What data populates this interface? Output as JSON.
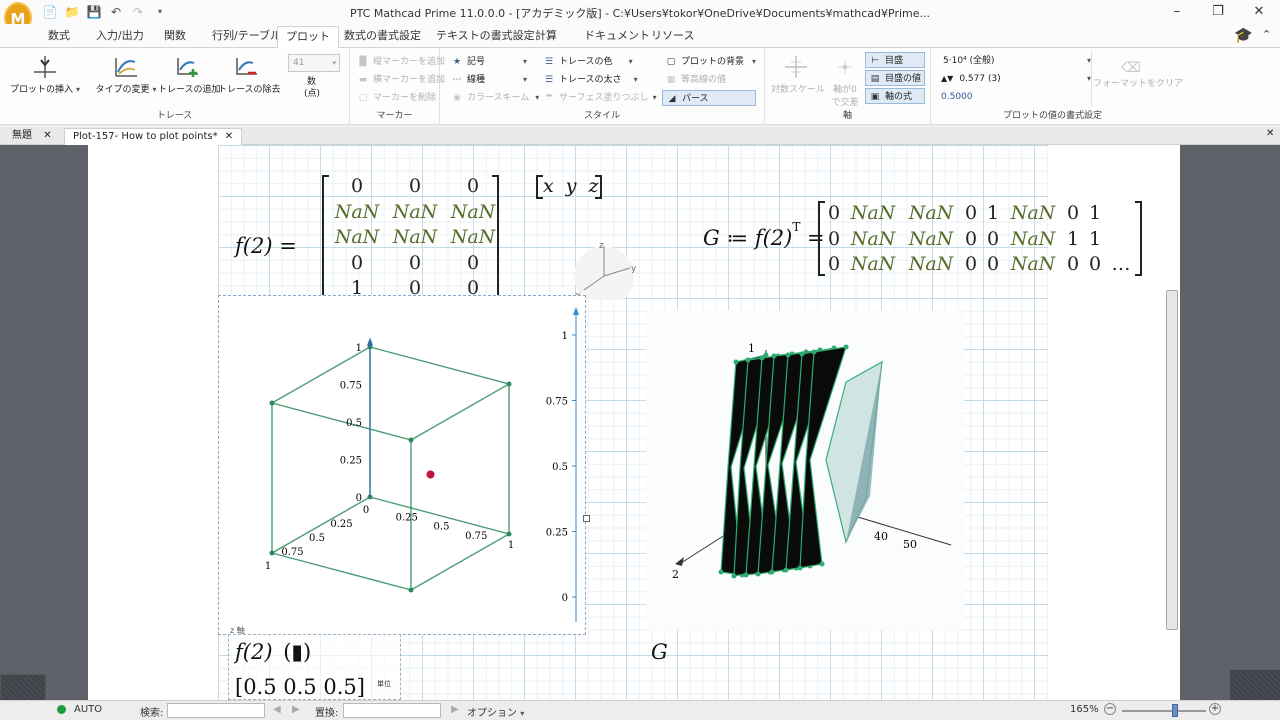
{
  "app": {
    "title": "PTC Mathcad Prime 11.0.0.0 - [アカデミック版] - C:¥Users¥tokor¥OneDrive¥Documents¥mathcad¥Prime...",
    "logo": "M"
  },
  "ribbon_tabs": [
    "数式",
    "入力/出力",
    "関数",
    "行列/テーブル",
    "プロット",
    "数式の書式設定",
    "テキストの書式設定",
    "計算",
    "ドキュメント",
    "リソース"
  ],
  "ribbon": {
    "trace": {
      "label": "トレース",
      "insert_plot": "プロットの挿入",
      "change_type": "タイプの変更",
      "add_trace": "トレースの追加",
      "remove_trace": "トレースの除去",
      "count_value": "41",
      "count_label_1": "数",
      "count_label_2": "(点)"
    },
    "marker": {
      "label": "マーカー",
      "add_vertical": "縦マーカーを追加",
      "add_horizontal": "横マーカーを追加",
      "delete": "マーカーを削除"
    },
    "style": {
      "label": "スタイル",
      "symbol": "記号",
      "line_style": "線種",
      "color_scheme": "カラースキーム",
      "trace_color": "トレースの色",
      "trace_weight": "トレースの太さ",
      "surface_fill": "サーフェス塗りつぶし",
      "plot_background": "プロットの背景",
      "contour_values": "等高線の値",
      "perspective": "パース"
    },
    "axes": {
      "label": "軸",
      "log_scale": "対数スケール",
      "axes_cross_1": "軸が0",
      "axes_cross_2": "で交差",
      "ticks": "目盛",
      "tick_values": "目盛の値",
      "axis_expression": "軸の式"
    },
    "format": {
      "label": "プロットの値の書式設定",
      "format_1": "5·10⁴ (全般)",
      "format_2": "0.577 (3)",
      "format_3": "0.5000",
      "clear": "フォーマットをクリア"
    }
  },
  "doc_tabs": [
    {
      "label": "無題",
      "active": false
    },
    {
      "label": "Plot-157- How to plot points*",
      "active": true
    }
  ],
  "worksheet": {
    "f2_label": "f(2) =",
    "f2_matrix": [
      [
        "0",
        "0",
        "0"
      ],
      [
        "NaN",
        "NaN",
        "NaN"
      ],
      [
        "NaN",
        "NaN",
        "NaN"
      ],
      [
        "0",
        "0",
        "0"
      ],
      [
        "1",
        "0",
        "0"
      ]
    ],
    "xyz": [
      "x",
      "y",
      "z"
    ],
    "g_def": "G ≔ f(2)",
    "g_sup": "T",
    "g_equals": "=",
    "g_matrix": [
      [
        "0",
        "NaN",
        "NaN",
        "0",
        "1",
        "NaN",
        "0",
        "1",
        ""
      ],
      [
        "0",
        "NaN",
        "NaN",
        "0",
        "0",
        "NaN",
        "1",
        "1",
        ""
      ],
      [
        "0",
        "NaN",
        "NaN",
        "0",
        "0",
        "NaN",
        "0",
        "0",
        "…"
      ]
    ],
    "plot1_trace_label": "z 軸",
    "plot1_expr": "f(2)",
    "plot1_expr_paren": "(▮)",
    "plot1_vector": "[0.5  0.5  0.5]",
    "plot1_unit": "単位",
    "g_label": "G",
    "orient": {
      "x": "x",
      "y": "y",
      "z": "z"
    }
  },
  "chart_data": [
    {
      "type": "scatter",
      "three_d": true,
      "points": [
        {
          "x": 0.5,
          "y": 0.5,
          "z": 0.5
        }
      ],
      "axis_ticks": {
        "x": [
          "1",
          "0.75",
          "0.5",
          "0.25",
          "0"
        ],
        "y": [
          "0.25",
          "0.5",
          "0.75",
          "1"
        ],
        "z": [
          "0",
          "0.25",
          "0.5",
          "0.75",
          "1"
        ]
      },
      "zlim": [
        0,
        1
      ],
      "point_color": "#c0143c",
      "box_color": "#2e8b5e"
    },
    {
      "type": "line",
      "scale_ticks": [
        "0",
        "0.25",
        "0.5",
        "0.75",
        "1"
      ],
      "ylim": [
        0,
        1
      ]
    },
    {
      "type": "surface",
      "three_d": true,
      "axis_ticks": {
        "x": [
          "40",
          "50"
        ],
        "y": [
          "2"
        ],
        "z": [
          "1"
        ]
      },
      "fill_color": "#0a0a0a",
      "edge_color": "#2eaa6e"
    }
  ],
  "tools": [
    "rotate-icon",
    "pan-icon",
    "zoom-icon",
    "reset-icon"
  ],
  "status": {
    "mode": "AUTO",
    "search_label": "検索:",
    "replace_label": "置換:",
    "options_label": "オプション",
    "zoom": "165%"
  }
}
